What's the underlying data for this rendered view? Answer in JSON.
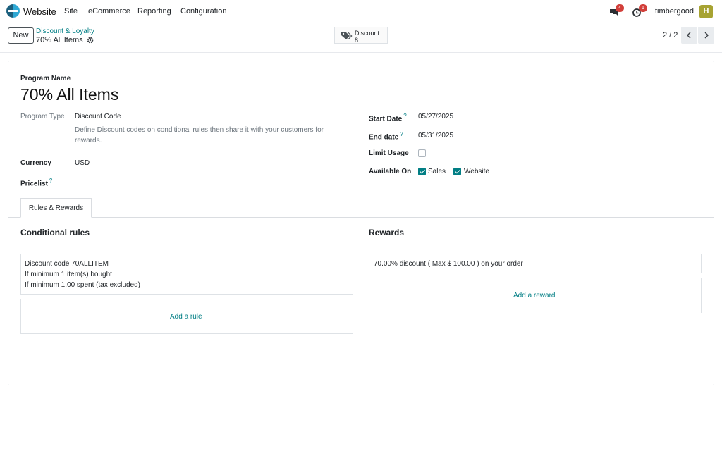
{
  "app": {
    "name": "Website"
  },
  "menu": [
    "Site",
    "eCommerce",
    "Reporting",
    "Configuration"
  ],
  "systray": {
    "messages_count": "4",
    "activities_count": "1",
    "username": "timbergood",
    "avatar_letter": "H"
  },
  "control": {
    "new_label": "New",
    "breadcrumb_parent": "Discount & Loyalty",
    "breadcrumb_current": "70% All Items",
    "smart_button_label": "Discount",
    "smart_button_count": "8",
    "pager_value": "2 / 2"
  },
  "form": {
    "program_name_label": "Program Name",
    "program_name": "70% All Items",
    "program_type_label": "Program Type",
    "program_type": "Discount Code",
    "program_type_help": "Define Discount codes on conditional rules then share it with your customers for rewards.",
    "currency_label": "Currency",
    "currency": "USD",
    "pricelist_label": "Pricelist",
    "help_mark": "?",
    "start_date_label": "Start Date",
    "start_date": "05/27/2025",
    "end_date_label": "End date",
    "end_date": "05/31/2025",
    "limit_usage_label": "Limit Usage",
    "limit_usage": false,
    "available_on_label": "Available On",
    "available_sales": "Sales",
    "available_website": "Website"
  },
  "tabs": {
    "rules_rewards": "Rules & Rewards"
  },
  "rules": {
    "title": "Conditional rules",
    "lines": [
      "Discount code 70ALLITEM",
      "If minimum 1 item(s) bought",
      "If minimum 1.00 spent (tax excluded)"
    ],
    "add_label": "Add a rule"
  },
  "rewards": {
    "title": "Rewards",
    "line": "70.00% discount ( Max $ 100.00 ) on your order",
    "add_label": "Add a reward"
  },
  "colors": {
    "accent": "#017e84",
    "badge": "#d23f3a",
    "avatar": "#a7a332"
  },
  "icons": [
    "website-logo-icon",
    "chat-icon",
    "clock-icon",
    "gear-icon",
    "tag-icon",
    "chevron-left-icon",
    "chevron-right-icon",
    "checkbox-icon"
  ]
}
